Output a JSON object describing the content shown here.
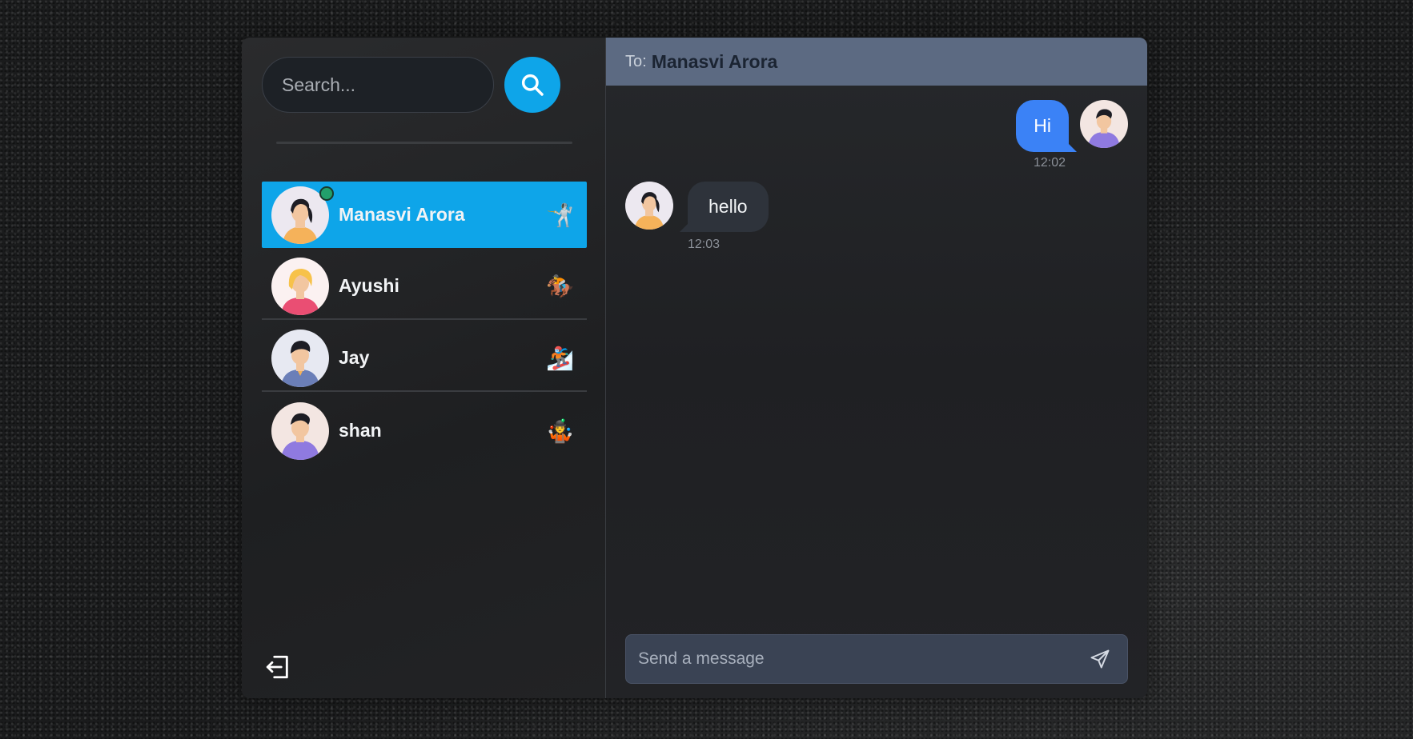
{
  "sidebar": {
    "search": {
      "placeholder": "Search..."
    },
    "contacts": [
      {
        "name": "Manasvi Arora",
        "emoji": "🤺",
        "active": true,
        "online": true
      },
      {
        "name": "Ayushi",
        "emoji": "🏇",
        "active": false,
        "online": false
      },
      {
        "name": "Jay",
        "emoji": "🏂",
        "active": false,
        "online": false
      },
      {
        "name": "shan",
        "emoji": "🤹",
        "active": false,
        "online": false
      }
    ]
  },
  "chat": {
    "to_label": "To:",
    "to_name": "Manasvi Arora",
    "messages": [
      {
        "direction": "out",
        "text": "Hi",
        "time": "12:02"
      },
      {
        "direction": "in",
        "text": "hello",
        "time": "12:03"
      }
    ],
    "composer": {
      "placeholder": "Send a message"
    }
  },
  "colors": {
    "accent": "#0ea5e9",
    "outgoing_bubble": "#3b82f6",
    "header": "#5c6a82"
  },
  "icons": [
    "search-icon",
    "logout-icon",
    "send-icon"
  ]
}
